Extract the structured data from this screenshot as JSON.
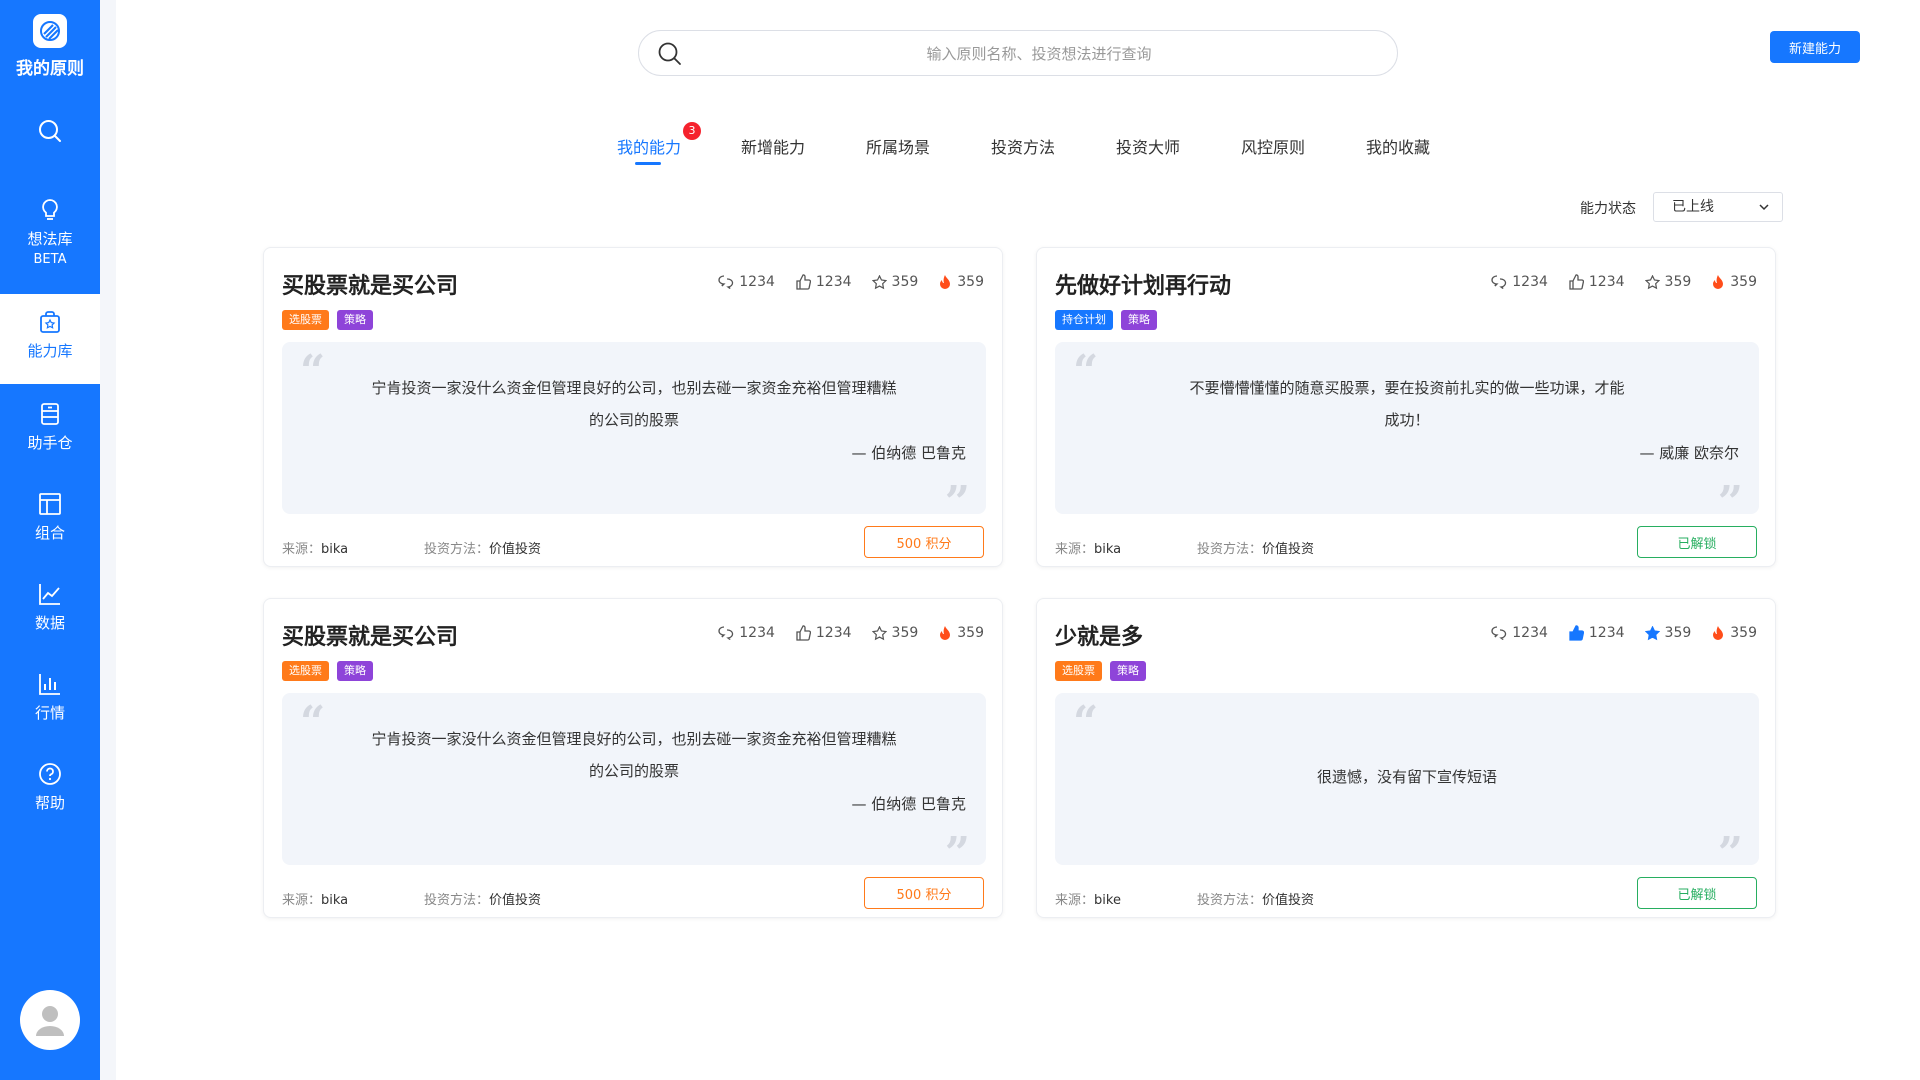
{
  "app": {
    "title": "我的原则"
  },
  "colors": {
    "primary": "#1677ff",
    "orange": "#ff7a1a",
    "purple": "#8e44d9",
    "blue_tag": "#1677ff",
    "green": "#27ae60"
  },
  "sidebar": {
    "items": [
      {
        "label": "",
        "icon": "search-icon"
      },
      {
        "label": "想法库",
        "sub": "BETA",
        "icon": "lightbulb-icon"
      },
      {
        "label": "能力库",
        "icon": "capability-bag-icon"
      },
      {
        "label": "助手仓",
        "icon": "cabinet-icon"
      },
      {
        "label": "组合",
        "icon": "layout-icon"
      },
      {
        "label": "数据",
        "icon": "line-chart-icon"
      },
      {
        "label": "行情",
        "icon": "bar-chart-icon"
      },
      {
        "label": "帮助",
        "icon": "help-icon"
      }
    ]
  },
  "search": {
    "placeholder": "输入原则名称、投资想法进行查询"
  },
  "header": {
    "new_button": "新建能力"
  },
  "tabs": [
    {
      "label": "我的能力",
      "badge": "3"
    },
    {
      "label": "新增能力"
    },
    {
      "label": "所属场景"
    },
    {
      "label": "投资方法"
    },
    {
      "label": "投资大师"
    },
    {
      "label": "风控原则"
    },
    {
      "label": "我的收藏"
    }
  ],
  "filter": {
    "label": "能力状态",
    "value": "已上线"
  },
  "meta_labels": {
    "source": "来源：",
    "method": "投资方法："
  },
  "cards": [
    {
      "title": "买股票就是买公司",
      "stats": {
        "comments": "1234",
        "likes": "1234",
        "stars": "359",
        "hot": "359"
      },
      "tags": [
        {
          "label": "选股票",
          "color": "orange"
        },
        {
          "label": "策略",
          "color": "purple"
        }
      ],
      "quote_line1": "宁肯投资一家没什么资金但管理良好的公司，也别去碰一家资金充裕但管理糟糕",
      "quote_line2": "的公司的股票",
      "author": "— 伯纳德 巴鲁克",
      "source": "bika",
      "method": "价值投资",
      "action": "500 积分",
      "action_type": "points"
    },
    {
      "title": "先做好计划再行动",
      "stats": {
        "comments": "1234",
        "likes": "1234",
        "stars": "359",
        "hot": "359"
      },
      "tags": [
        {
          "label": "持仓计划",
          "color": "blue"
        },
        {
          "label": "策略",
          "color": "purple"
        }
      ],
      "quote_line1": "不要懵懵懂懂的随意买股票，要在投资前扎实的做一些功课，才能",
      "quote_line2": "成功！",
      "author": "— 威廉 欧奈尔",
      "source": "bika",
      "method": "价值投资",
      "action": "已解锁",
      "action_type": "unlocked"
    },
    {
      "title": "买股票就是买公司",
      "stats": {
        "comments": "1234",
        "likes": "1234",
        "stars": "359",
        "hot": "359"
      },
      "tags": [
        {
          "label": "选股票",
          "color": "orange"
        },
        {
          "label": "策略",
          "color": "purple"
        }
      ],
      "quote_line1": "宁肯投资一家没什么资金但管理良好的公司，也别去碰一家资金充裕但管理糟糕",
      "quote_line2": "的公司的股票",
      "author": "— 伯纳德 巴鲁克",
      "source": "bika",
      "method": "价值投资",
      "action": "500 积分",
      "action_type": "points"
    },
    {
      "title": "少就是多",
      "stats": {
        "comments": "1234",
        "likes": "1234",
        "stars": "359",
        "hot": "359"
      },
      "tags": [
        {
          "label": "选股票",
          "color": "orange"
        },
        {
          "label": "策略",
          "color": "purple"
        }
      ],
      "quote_line1": "很遗憾，没有留下宣传短语",
      "source": "bike",
      "method": "价值投资",
      "action": "已解锁",
      "action_type": "unlocked",
      "liked": true
    }
  ]
}
